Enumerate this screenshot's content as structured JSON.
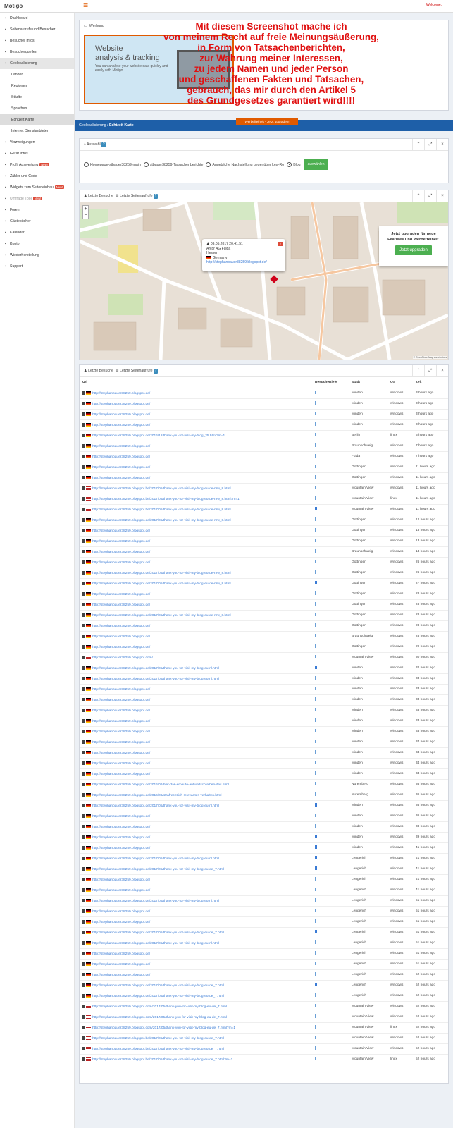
{
  "app": {
    "logo": "Motigo",
    "welcome": "Welcome,",
    "menu_icon": "hamburger-icon"
  },
  "sidebar": {
    "items": [
      {
        "label": "Dashboard",
        "icon": "dashboard-icon"
      },
      {
        "label": "Seitenaufrufe und Besucher",
        "icon": "eye-icon"
      },
      {
        "label": "Besucher Infos",
        "icon": "user-icon"
      },
      {
        "label": "Besucherquellen",
        "icon": "globe-icon"
      },
      {
        "label": "Geolokalisierung",
        "icon": "target-icon",
        "active": true
      },
      {
        "label": "Länder",
        "sub": true
      },
      {
        "label": "Regionen",
        "sub": true
      },
      {
        "label": "Städte",
        "sub": true
      },
      {
        "label": "Sprachen",
        "sub": true
      },
      {
        "label": "Echtzeit Karte",
        "sub": true,
        "active": true
      },
      {
        "label": "Internet Dienstanbieter",
        "sub": true
      },
      {
        "label": "Verzweigungen",
        "icon": "branch-icon"
      },
      {
        "label": "Gerät Infos",
        "icon": "device-icon"
      },
      {
        "label": "Profil Auswertung",
        "icon": "profile-icon",
        "badge": "New!"
      },
      {
        "label": "Zähler und Code",
        "icon": "code-icon"
      },
      {
        "label": "Widgets zum Seiteneinbau",
        "icon": "widget-icon",
        "badge": "New!"
      },
      {
        "label": "Umfrage Tool",
        "icon": "poll-icon",
        "badge": "New!",
        "muted": true
      },
      {
        "label": "Foren",
        "icon": "forum-icon"
      },
      {
        "label": "Gästebücher",
        "icon": "book-icon"
      },
      {
        "label": "Kalendar",
        "icon": "calendar-icon"
      },
      {
        "label": "Konto",
        "icon": "account-icon"
      },
      {
        "label": "Wiederherstellung",
        "icon": "restore-icon"
      },
      {
        "label": "Support",
        "icon": "phone-icon"
      }
    ]
  },
  "ad_panel": {
    "title": "Werbung",
    "ad_heading_1": "Website",
    "ad_heading_2": "analysis & tracking",
    "ad_text": "You can analyse your website data quickly and easily with Motigo.",
    "cta": "Werbefreiheit - Jetzt upgraden!"
  },
  "overlay_lines": [
    "Mit diesem Screenshot mache ich",
    "von meinem Recht auf freie Meinungsäußerung,",
    "in Form von Tatsachenberichten,",
    "zur Wahrung meiner Interessen,",
    "zu jedem Namen und jeder Person",
    "und geschaffenen Fakten und Tatsachen,",
    "gebrauch, das mir durch den Artikel 5",
    "des Grundgesetzes garantiert wird!!!!"
  ],
  "breadcrumb": {
    "parent": "Geolokalisierung",
    "separator": "/",
    "current": "Echtzeit Karte"
  },
  "auswahl": {
    "title": "Auswahl",
    "options": [
      {
        "label": "Homepage-stbauer38259-main",
        "selected": false
      },
      {
        "label": "stbauer38259-Tatsachenberichte",
        "selected": false
      },
      {
        "label": "Angebliche Nachstellung gegenüber Lea-Ro",
        "selected": false
      },
      {
        "label": "Blog",
        "selected": true
      }
    ],
    "button": "auswählen"
  },
  "map_panel": {
    "tab1": "Letzte Besuche",
    "tab2": "Letzte Seitenaufrufe",
    "popup": {
      "datetime": "09.05.2017 20:41:51",
      "isp": "Arcor AG Fulda",
      "region": "Hessen",
      "country": "Germany",
      "url": "http://stephanbauer38259.blogspot.de/"
    },
    "upgrade_text_1": "Jetzt upgraden für neue",
    "upgrade_text_2": "Features und Werbefreiheit.",
    "upgrade_button": "Jetzt upgraden",
    "attribution": "© OpenStreetMap contributors",
    "zoom_in": "+",
    "zoom_out": "−"
  },
  "visits_panel": {
    "tab1": "Letzte Besuche",
    "tab2": "Letzte Seitenaufrufe",
    "columns": [
      "Url",
      "Besuchertiefe",
      "Stadt",
      "OS",
      "Zeit"
    ],
    "rows": [
      [
        "de",
        "http://stephanbauer38259.blogspot.de/",
        "s",
        "Minden",
        "windows",
        "3 hours ago"
      ],
      [
        "de",
        "http://stephanbauer38259.blogspot.de/",
        "s",
        "Minden",
        "windows",
        "3 hours ago"
      ],
      [
        "de",
        "http://stephanbauer38259.blogspot.de/",
        "s",
        "Minden",
        "windows",
        "3 hours ago"
      ],
      [
        "de",
        "http://stephanbauer38259.blogspot.de/",
        "s",
        "Minden",
        "windows",
        "3 hours ago"
      ],
      [
        "de",
        "http://stephanbauer38259.blogspot.de/2016/12/thank-you-for-visit-my-blog_25.html?m=1",
        "s",
        "Berlin",
        "linux",
        "5 hours ago"
      ],
      [
        "de",
        "http://stephanbauer38259.blogspot.de/",
        "s",
        "Braunschweig",
        "windows",
        "7 hours ago"
      ],
      [
        "de",
        "http://stephanbauer38259.blogspot.de/",
        "s",
        "Fulda",
        "windows",
        "7 hours ago"
      ],
      [
        "de",
        "http://stephanbauer38259.blogspot.de/",
        "s",
        "Gottingen",
        "windows",
        "11 hours ago"
      ],
      [
        "de",
        "http://stephanbauer38259.blogspot.de/",
        "s",
        "Gottingen",
        "windows",
        "11 hours ago"
      ],
      [
        "us",
        "http://stephanbauer38259.blogspot.be/2017/05/thank-you-for-visit-my-blog-eu-de-nrw_8.html",
        "s",
        "Mountain View",
        "windows",
        "11 hours ago"
      ],
      [
        "us",
        "http://stephanbauer38259.blogspot.be/2017/05/thank-you-for-visit-my-blog-eu-de-nrw_8.html?m=1",
        "s",
        "Mountain View",
        "linux",
        "11 hours ago"
      ],
      [
        "us",
        "http://stephanbauer38259.blogspot.be/2017/05/thank-you-for-visit-my-blog-eu-de-nrw_8.html",
        "b",
        "Mountain View",
        "windows",
        "11 hours ago"
      ],
      [
        "de",
        "http://stephanbauer38259.blogspot.de/2017/05/thank-you-for-visit-my-blog-eu-de-nrw_8.html",
        "s",
        "Gottingen",
        "windows",
        "12 hours ago"
      ],
      [
        "de",
        "http://stephanbauer38259.blogspot.de/",
        "s",
        "Gottingen",
        "windows",
        "13 hours ago"
      ],
      [
        "de",
        "http://stephanbauer38259.blogspot.de/",
        "s",
        "Gottingen",
        "windows",
        "13 hours ago"
      ],
      [
        "de",
        "http://stephanbauer38259.blogspot.de/",
        "s",
        "Braunschweig",
        "windows",
        "14 hours ago"
      ],
      [
        "de",
        "http://stephanbauer38259.blogspot.de/",
        "s",
        "Gottingen",
        "windows",
        "26 hours ago"
      ],
      [
        "de",
        "http://stephanbauer38259.blogspot.de/2017/05/thank-you-for-visit-my-blog-eu-de-nrw_8.html",
        "s",
        "Gottingen",
        "windows",
        "26 hours ago"
      ],
      [
        "de",
        "http://stephanbauer38259.blogspot.de/2017/05/thank-you-for-visit-my-blog-eu-de-nrw_8.html",
        "b",
        "Gottingen",
        "windows",
        "27 hours ago"
      ],
      [
        "de",
        "http://stephanbauer38259.blogspot.de/",
        "s",
        "Gottingen",
        "windows",
        "28 hours ago"
      ],
      [
        "de",
        "http://stephanbauer38259.blogspot.de/",
        "s",
        "Gottingen",
        "windows",
        "28 hours ago"
      ],
      [
        "de",
        "http://stephanbauer38259.blogspot.de/2017/05/thank-you-for-visit-my-blog-eu-de-nrw_8.html",
        "s",
        "Gottingen",
        "windows",
        "28 hours ago"
      ],
      [
        "de",
        "http://stephanbauer38259.blogspot.de/",
        "s",
        "Gottingen",
        "windows",
        "28 hours ago"
      ],
      [
        "de",
        "http://stephanbauer38259.blogspot.de/",
        "s",
        "Braunschweig",
        "windows",
        "28 hours ago"
      ],
      [
        "de",
        "http://stephanbauer38259.blogspot.de/",
        "s",
        "Gottingen",
        "windows",
        "29 hours ago"
      ],
      [
        "us",
        "http://stephanbauer38259.blogspot.com/",
        "s",
        "Mountain View",
        "windows",
        "30 hours ago"
      ],
      [
        "de",
        "http://stephanbauer38259.blogspot.de/2017/05/thank-you-for-visit-my-blog-eu-nl.html",
        "b",
        "Minden",
        "windows",
        "32 hours ago"
      ],
      [
        "de",
        "http://stephanbauer38259.blogspot.de/2017/05/thank-you-for-visit-my-blog-eu-nl.html",
        "s",
        "Minden",
        "windows",
        "33 hours ago"
      ],
      [
        "de",
        "http://stephanbauer38259.blogspot.de/",
        "s",
        "Minden",
        "windows",
        "33 hours ago"
      ],
      [
        "de",
        "http://stephanbauer38259.blogspot.de/",
        "s",
        "Minden",
        "windows",
        "33 hours ago"
      ],
      [
        "de",
        "http://stephanbauer38259.blogspot.de/",
        "s",
        "Minden",
        "windows",
        "33 hours ago"
      ],
      [
        "de",
        "http://stephanbauer38259.blogspot.de/",
        "s",
        "Minden",
        "windows",
        "33 hours ago"
      ],
      [
        "de",
        "http://stephanbauer38259.blogspot.de/",
        "s",
        "Minden",
        "windows",
        "33 hours ago"
      ],
      [
        "de",
        "http://stephanbauer38259.blogspot.de/",
        "s",
        "Minden",
        "windows",
        "34 hours ago"
      ],
      [
        "de",
        "http://stephanbauer38259.blogspot.de/",
        "s",
        "Minden",
        "windows",
        "34 hours ago"
      ],
      [
        "de",
        "http://stephanbauer38259.blogspot.de/",
        "s",
        "Minden",
        "windows",
        "34 hours ago"
      ],
      [
        "de",
        "http://stephanbauer38259.blogspot.de/",
        "s",
        "Minden",
        "windows",
        "34 hours ago"
      ],
      [
        "de",
        "http://stephanbauer38259.blogspot.de/2016/06/hier-das-erneute-antwortschreiben-des.html",
        "s",
        "Nuremberg",
        "windows",
        "36 hours ago"
      ],
      [
        "de",
        "http://stephanbauer38259.blogspot.de/2016/06/strafrechtlich-relevantes-verhalten.html",
        "s",
        "Nuremberg",
        "windows",
        "36 hours ago"
      ],
      [
        "de",
        "http://stephanbauer38259.blogspot.de/2017/05/thank-you-for-visit-my-blog-eu-nl.html",
        "b",
        "Minden",
        "windows",
        "36 hours ago"
      ],
      [
        "de",
        "http://stephanbauer38259.blogspot.de/",
        "s",
        "Minden",
        "windows",
        "36 hours ago"
      ],
      [
        "de",
        "http://stephanbauer38259.blogspot.de/",
        "s",
        "Minden",
        "windows",
        "38 hours ago"
      ],
      [
        "de",
        "http://stephanbauer38259.blogspot.de/",
        "b",
        "Minden",
        "windows",
        "39 hours ago"
      ],
      [
        "de",
        "http://stephanbauer38259.blogspot.de/",
        "b",
        "Minden",
        "windows",
        "41 hours ago"
      ],
      [
        "de",
        "http://stephanbauer38259.blogspot.de/2017/05/thank-you-for-visit-my-blog-eu-nl.html",
        "b",
        "Lengerich",
        "windows",
        "41 hours ago"
      ],
      [
        "de",
        "http://stephanbauer38259.blogspot.de/2017/05/thank-you-for-visit-my-blog-eu-de_7.html",
        "b",
        "Lengerich",
        "windows",
        "41 hours ago"
      ],
      [
        "de",
        "http://stephanbauer38259.blogspot.de/",
        "s",
        "Lengerich",
        "windows",
        "41 hours ago"
      ],
      [
        "de",
        "http://stephanbauer38259.blogspot.de/",
        "s",
        "Lengerich",
        "windows",
        "41 hours ago"
      ],
      [
        "de",
        "http://stephanbauer38259.blogspot.de/2017/05/thank-you-for-visit-my-blog-eu-nl.html",
        "s",
        "Lengerich",
        "windows",
        "51 hours ago"
      ],
      [
        "de",
        "http://stephanbauer38259.blogspot.de/",
        "s",
        "Lengerich",
        "windows",
        "51 hours ago"
      ],
      [
        "de",
        "http://stephanbauer38259.blogspot.de/",
        "s",
        "Lengerich",
        "windows",
        "51 hours ago"
      ],
      [
        "de",
        "http://stephanbauer38259.blogspot.de/2017/05/thank-you-for-visit-my-blog-eu-de_7.html",
        "b",
        "Lengerich",
        "windows",
        "51 hours ago"
      ],
      [
        "de",
        "http://stephanbauer38259.blogspot.de/2017/05/thank-you-for-visit-my-blog-eu-nl.html",
        "s",
        "Lengerich",
        "windows",
        "51 hours ago"
      ],
      [
        "de",
        "http://stephanbauer38259.blogspot.de/",
        "s",
        "Lengerich",
        "windows",
        "51 hours ago"
      ],
      [
        "de",
        "http://stephanbauer38259.blogspot.de/",
        "s",
        "Lengerich",
        "windows",
        "51 hours ago"
      ],
      [
        "de",
        "http://stephanbauer38259.blogspot.de/",
        "s",
        "Lengerich",
        "windows",
        "52 hours ago"
      ],
      [
        "de",
        "http://stephanbauer38259.blogspot.de/2017/05/thank-you-for-visit-my-blog-eu-de_7.html",
        "b",
        "Lengerich",
        "windows",
        "52 hours ago"
      ],
      [
        "de",
        "http://stephanbauer38259.blogspot.de/2017/05/thank-you-for-visit-my-blog-eu-de_7.html",
        "s",
        "Lengerich",
        "windows",
        "52 hours ago"
      ],
      [
        "us",
        "http://stephanbauer38259.blogspot.com/2017/05/thank-you-for-visit-my-blog-eu-de_7.html",
        "s",
        "Mountain View",
        "windows",
        "52 hours ago"
      ],
      [
        "us",
        "http://stephanbauer38259.blogspot.com/2017/05/thank-you-for-visit-my-blog-eu-de_7.html",
        "s",
        "Mountain View",
        "windows",
        "52 hours ago"
      ],
      [
        "us",
        "http://stephanbauer38259.blogspot.com/2017/05/thank-you-for-visit-my-blog-eu-de_7.html?m=1",
        "s",
        "Mountain View",
        "linux",
        "52 hours ago"
      ],
      [
        "us",
        "http://stephanbauer38259.blogspot.be/2017/05/thank-you-for-visit-my-blog-eu-de_7.html",
        "s",
        "Mountain View",
        "windows",
        "52 hours ago"
      ],
      [
        "us",
        "http://stephanbauer38259.blogspot.be/2017/05/thank-you-for-visit-my-blog-eu-de_7.html",
        "s",
        "Mountain View",
        "windows",
        "52 hours ago"
      ],
      [
        "us",
        "http://stephanbauer38259.blogspot.be/2017/05/thank-you-for-visit-my-blog-eu-de_7.html?m=1",
        "s",
        "Mountain View",
        "linux",
        "52 hours ago"
      ]
    ]
  }
}
